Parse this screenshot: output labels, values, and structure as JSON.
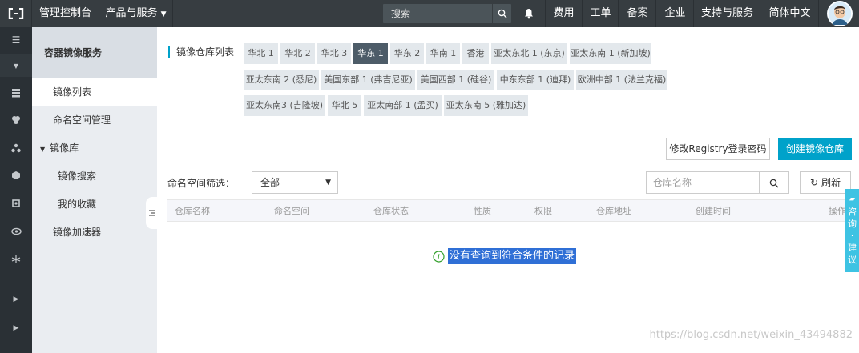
{
  "header": {
    "console_label": "管理控制台",
    "products_label": "产品与服务",
    "search_placeholder": "搜索",
    "links": [
      "费用",
      "工单",
      "备案",
      "企业",
      "支持与服务",
      "简体中文"
    ]
  },
  "sidebar": {
    "title": "容器镜像服务",
    "items": [
      {
        "label": "镜像列表"
      },
      {
        "label": "命名空间管理"
      },
      {
        "label": "镜像库"
      },
      {
        "label": "镜像搜索"
      },
      {
        "label": "我的收藏"
      },
      {
        "label": "镜像加速器"
      }
    ]
  },
  "main": {
    "title": "镜像仓库列表",
    "regions": [
      "华北 1",
      "华北 2",
      "华北 3",
      "华东 1",
      "华东 2",
      "华南 1",
      "香港",
      "亚太东北 1 (东京)",
      "亚太东南 1 (新加坡)",
      "亚太东南 2 (悉尼)",
      "美国东部 1 (弗吉尼亚)",
      "美国西部 1 (硅谷)",
      "中东东部 1 (迪拜)",
      "欧洲中部 1 (法兰克福)",
      "亚太东南3 (吉隆坡)",
      "华北 5",
      "亚太南部 1 (孟买)",
      "亚太东南 5 (雅加达)"
    ],
    "active_region": "华东 1",
    "modify_password_label": "修改Registry登录密码",
    "create_repo_label": "创建镜像仓库",
    "namespace_filter_label": "命名空间筛选：",
    "namespace_filter_value": "全部",
    "repo_search_placeholder": "仓库名称",
    "refresh_label": "刷新",
    "columns": [
      "仓库名称",
      "命名空间",
      "仓库状态",
      "性质",
      "权限",
      "仓库地址",
      "创建时间",
      "操作"
    ],
    "empty_message": "没有查询到符合条件的记录"
  },
  "feedback": {
    "label": "咨询·建议"
  },
  "watermark": "https://blog.csdn.net/weixin_43494882",
  "colors": {
    "topbar": "#373d41",
    "accent": "#00a2ca",
    "active_region": "#4d5c68"
  }
}
